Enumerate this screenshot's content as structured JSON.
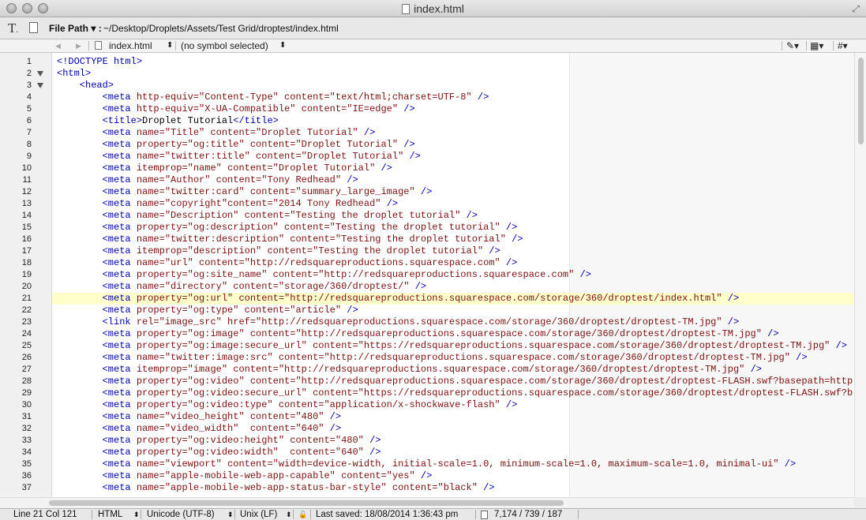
{
  "window": {
    "title": "index.html"
  },
  "toolbar": {
    "file_path_label": "File Path ▾ :",
    "file_path_value": "~/Desktop/Droplets/Assets/Test Grid/droptest/index.html"
  },
  "navbar": {
    "back": "◀",
    "forward": "▶",
    "file": "index.html",
    "file_chevron": "⬍",
    "symbol": "(no symbol selected)",
    "symbol_chevron": "⬍",
    "pencil": "✎▾",
    "bookmark": "▦▾",
    "hash": "#▾"
  },
  "editor": {
    "current_line": 21,
    "lines": [
      {
        "n": "1",
        "fold": false,
        "c": [
          [
            "#0000aa",
            "<!DOCTYPE html>"
          ]
        ]
      },
      {
        "n": "2",
        "fold": true,
        "c": [
          [
            "#0000aa",
            "<html>"
          ]
        ]
      },
      {
        "n": "3",
        "fold": true,
        "c": [
          [
            "#0000aa",
            "    <head>"
          ]
        ]
      },
      {
        "n": "4",
        "fold": false,
        "c": [
          [
            "#0000aa",
            "        <meta "
          ],
          [
            "#7a1212",
            "http-equiv=\"Content-Type\" content=\"text/html;charset=UTF-8\" "
          ],
          [
            "#0000aa",
            "/>"
          ]
        ]
      },
      {
        "n": "5",
        "fold": false,
        "c": [
          [
            "#0000aa",
            "        <meta "
          ],
          [
            "#7a1212",
            "http-equiv=\"X-UA-Compatible\" content=\"IE=edge\" "
          ],
          [
            "#0000aa",
            "/>"
          ]
        ]
      },
      {
        "n": "6",
        "fold": false,
        "c": [
          [
            "#0000aa",
            "        <title>"
          ],
          [
            "#000000",
            "Droplet Tutorial"
          ],
          [
            "#0000aa",
            "</title>"
          ]
        ]
      },
      {
        "n": "7",
        "fold": false,
        "c": [
          [
            "#0000aa",
            "        <meta "
          ],
          [
            "#7a1212",
            "name=\"Title\" content=\"Droplet Tutorial\" "
          ],
          [
            "#0000aa",
            "/>"
          ]
        ]
      },
      {
        "n": "8",
        "fold": false,
        "c": [
          [
            "#0000aa",
            "        <meta "
          ],
          [
            "#7a1212",
            "property=\"og:title\" content=\"Droplet Tutorial\" "
          ],
          [
            "#0000aa",
            "/>"
          ]
        ]
      },
      {
        "n": "9",
        "fold": false,
        "c": [
          [
            "#0000aa",
            "        <meta "
          ],
          [
            "#7a1212",
            "name=\"twitter:title\" content=\"Droplet Tutorial\" "
          ],
          [
            "#0000aa",
            "/>"
          ]
        ]
      },
      {
        "n": "10",
        "fold": false,
        "c": [
          [
            "#0000aa",
            "        <meta "
          ],
          [
            "#7a1212",
            "itemprop=\"name\" content=\"Droplet Tutorial\" "
          ],
          [
            "#0000aa",
            "/>"
          ]
        ]
      },
      {
        "n": "11",
        "fold": false,
        "c": [
          [
            "#0000aa",
            "        <meta "
          ],
          [
            "#7a1212",
            "name=\"Author\" content=\"Tony Redhead\" "
          ],
          [
            "#0000aa",
            "/>"
          ]
        ]
      },
      {
        "n": "12",
        "fold": false,
        "c": [
          [
            "#0000aa",
            "        <meta "
          ],
          [
            "#7a1212",
            "name=\"twitter:card\" content=\"summary_large_image\" "
          ],
          [
            "#0000aa",
            "/>"
          ]
        ]
      },
      {
        "n": "13",
        "fold": false,
        "c": [
          [
            "#0000aa",
            "        <meta "
          ],
          [
            "#7a1212",
            "name=\"copyright\"content=\"2014 Tony Redhead\" "
          ],
          [
            "#0000aa",
            "/>"
          ]
        ]
      },
      {
        "n": "14",
        "fold": false,
        "c": [
          [
            "#0000aa",
            "        <meta "
          ],
          [
            "#7a1212",
            "name=\"Description\" content=\"Testing the droplet tutorial\" "
          ],
          [
            "#0000aa",
            "/>"
          ]
        ]
      },
      {
        "n": "15",
        "fold": false,
        "c": [
          [
            "#0000aa",
            "        <meta "
          ],
          [
            "#7a1212",
            "property=\"og:description\" content=\"Testing the droplet tutorial\" "
          ],
          [
            "#0000aa",
            "/>"
          ]
        ]
      },
      {
        "n": "16",
        "fold": false,
        "c": [
          [
            "#0000aa",
            "        <meta "
          ],
          [
            "#7a1212",
            "name=\"twitter:description\" content=\"Testing the droplet tutorial\" "
          ],
          [
            "#0000aa",
            "/>"
          ]
        ]
      },
      {
        "n": "17",
        "fold": false,
        "c": [
          [
            "#0000aa",
            "        <meta "
          ],
          [
            "#7a1212",
            "itemprop=\"description\" content=\"Testing the droplet tutorial\" "
          ],
          [
            "#0000aa",
            "/>"
          ]
        ]
      },
      {
        "n": "18",
        "fold": false,
        "c": [
          [
            "#0000aa",
            "        <meta "
          ],
          [
            "#7a1212",
            "name=\"url\" content=\"http://redsquareproductions.squarespace.com\" "
          ],
          [
            "#0000aa",
            "/>"
          ]
        ]
      },
      {
        "n": "19",
        "fold": false,
        "c": [
          [
            "#0000aa",
            "        <meta "
          ],
          [
            "#7a1212",
            "property=\"og:site_name\" content=\"http://redsquareproductions.squarespace.com\" "
          ],
          [
            "#0000aa",
            "/>"
          ]
        ]
      },
      {
        "n": "20",
        "fold": false,
        "c": [
          [
            "#0000aa",
            "        <meta "
          ],
          [
            "#7a1212",
            "name=\"directory\" content=\"storage/360/droptest/\" "
          ],
          [
            "#0000aa",
            "/>"
          ]
        ]
      },
      {
        "n": "21",
        "fold": false,
        "c": [
          [
            "#0000aa",
            "        <meta "
          ],
          [
            "#7a1212",
            "property=\"og:url\" content=\"http://redsquareproductions.squarespace.com/storage/360/droptest/index.html\" "
          ],
          [
            "#0000aa",
            "/>"
          ]
        ]
      },
      {
        "n": "22",
        "fold": false,
        "c": [
          [
            "#0000aa",
            "        <meta "
          ],
          [
            "#7a1212",
            "property=\"og:type\" content=\"article\" "
          ],
          [
            "#0000aa",
            "/>"
          ]
        ]
      },
      {
        "n": "23",
        "fold": false,
        "c": [
          [
            "#0000aa",
            "        <link "
          ],
          [
            "#7a1212",
            "rel=\"image_src\" href=\"http://redsquareproductions.squarespace.com/storage/360/droptest/droptest-TM.jpg\" "
          ],
          [
            "#0000aa",
            "/>"
          ]
        ]
      },
      {
        "n": "24",
        "fold": false,
        "c": [
          [
            "#0000aa",
            "        <meta "
          ],
          [
            "#7a1212",
            "property=\"og:image\" content=\"http://redsquareproductions.squarespace.com/storage/360/droptest/droptest-TM.jpg\" "
          ],
          [
            "#0000aa",
            "/>"
          ]
        ]
      },
      {
        "n": "25",
        "fold": false,
        "c": [
          [
            "#0000aa",
            "        <meta "
          ],
          [
            "#7a1212",
            "property=\"og:image:secure_url\" content=\"https://redsquareproductions.squarespace.com/storage/360/droptest/droptest-TM.jpg\" "
          ],
          [
            "#0000aa",
            "/>"
          ]
        ]
      },
      {
        "n": "26",
        "fold": false,
        "c": [
          [
            "#0000aa",
            "        <meta "
          ],
          [
            "#7a1212",
            "name=\"twitter:image:src\" content=\"http://redsquareproductions.squarespace.com/storage/360/droptest/droptest-TM.jpg\" "
          ],
          [
            "#0000aa",
            "/>"
          ]
        ]
      },
      {
        "n": "27",
        "fold": false,
        "c": [
          [
            "#0000aa",
            "        <meta "
          ],
          [
            "#7a1212",
            "itemprop=\"image\" content=\"http://redsquareproductions.squarespace.com/storage/360/droptest/droptest-TM.jpg\" "
          ],
          [
            "#0000aa",
            "/>"
          ]
        ]
      },
      {
        "n": "28",
        "fold": false,
        "c": [
          [
            "#0000aa",
            "        <meta "
          ],
          [
            "#7a1212",
            "property=\"og:video\" content=\"http://redsquareproductions.squarespace.com/storage/360/droptest/droptest-FLASH.swf?basepath=http"
          ]
        ]
      },
      {
        "n": "29",
        "fold": false,
        "c": [
          [
            "#0000aa",
            "        <meta "
          ],
          [
            "#7a1212",
            "property=\"og:video:secure_url\" content=\"https://redsquareproductions.squarespace.com/storage/360/droptest/droptest-FLASH.swf?b"
          ]
        ]
      },
      {
        "n": "30",
        "fold": false,
        "c": [
          [
            "#0000aa",
            "        <meta "
          ],
          [
            "#7a1212",
            "property=\"og:video:type\" content=\"application/x-shockwave-flash\" "
          ],
          [
            "#0000aa",
            "/>"
          ]
        ]
      },
      {
        "n": "31",
        "fold": false,
        "c": [
          [
            "#0000aa",
            "        <meta "
          ],
          [
            "#7a1212",
            "name=\"video_height\" content=\"480\" "
          ],
          [
            "#0000aa",
            "/>"
          ]
        ]
      },
      {
        "n": "32",
        "fold": false,
        "c": [
          [
            "#0000aa",
            "        <meta "
          ],
          [
            "#7a1212",
            "name=\"video_width\"  content=\"640\" "
          ],
          [
            "#0000aa",
            "/>"
          ]
        ]
      },
      {
        "n": "33",
        "fold": false,
        "c": [
          [
            "#0000aa",
            "        <meta "
          ],
          [
            "#7a1212",
            "property=\"og:video:height\" content=\"480\" "
          ],
          [
            "#0000aa",
            "/>"
          ]
        ]
      },
      {
        "n": "34",
        "fold": false,
        "c": [
          [
            "#0000aa",
            "        <meta "
          ],
          [
            "#7a1212",
            "property=\"og:video:width\"  content=\"640\" "
          ],
          [
            "#0000aa",
            "/>"
          ]
        ]
      },
      {
        "n": "35",
        "fold": false,
        "c": [
          [
            "#0000aa",
            "        <meta "
          ],
          [
            "#7a1212",
            "name=\"viewport\" content=\"width=device-width, initial-scale=1.0, minimum-scale=1.0, maximum-scale=1.0, minimal-ui\" "
          ],
          [
            "#0000aa",
            "/>"
          ]
        ]
      },
      {
        "n": "36",
        "fold": false,
        "c": [
          [
            "#0000aa",
            "        <meta "
          ],
          [
            "#7a1212",
            "name=\"apple-mobile-web-app-capable\" content=\"yes\" "
          ],
          [
            "#0000aa",
            "/>"
          ]
        ]
      },
      {
        "n": "37",
        "fold": false,
        "c": [
          [
            "#0000aa",
            "        <meta "
          ],
          [
            "#7a1212",
            "name=\"apple-mobile-web-app-status-bar-style\" content=\"black\" "
          ],
          [
            "#0000aa",
            "/>"
          ]
        ]
      }
    ]
  },
  "status": {
    "position": "Line 21 Col 121",
    "language": "HTML",
    "encoding": "Unicode (UTF-8)",
    "line_endings": "Unix (LF)",
    "chevron": "⬍",
    "lock": "🔓",
    "last_saved": "Last saved: 18/08/2014 1:36:43 pm",
    "counts": "7,174 / 739 / 187"
  }
}
